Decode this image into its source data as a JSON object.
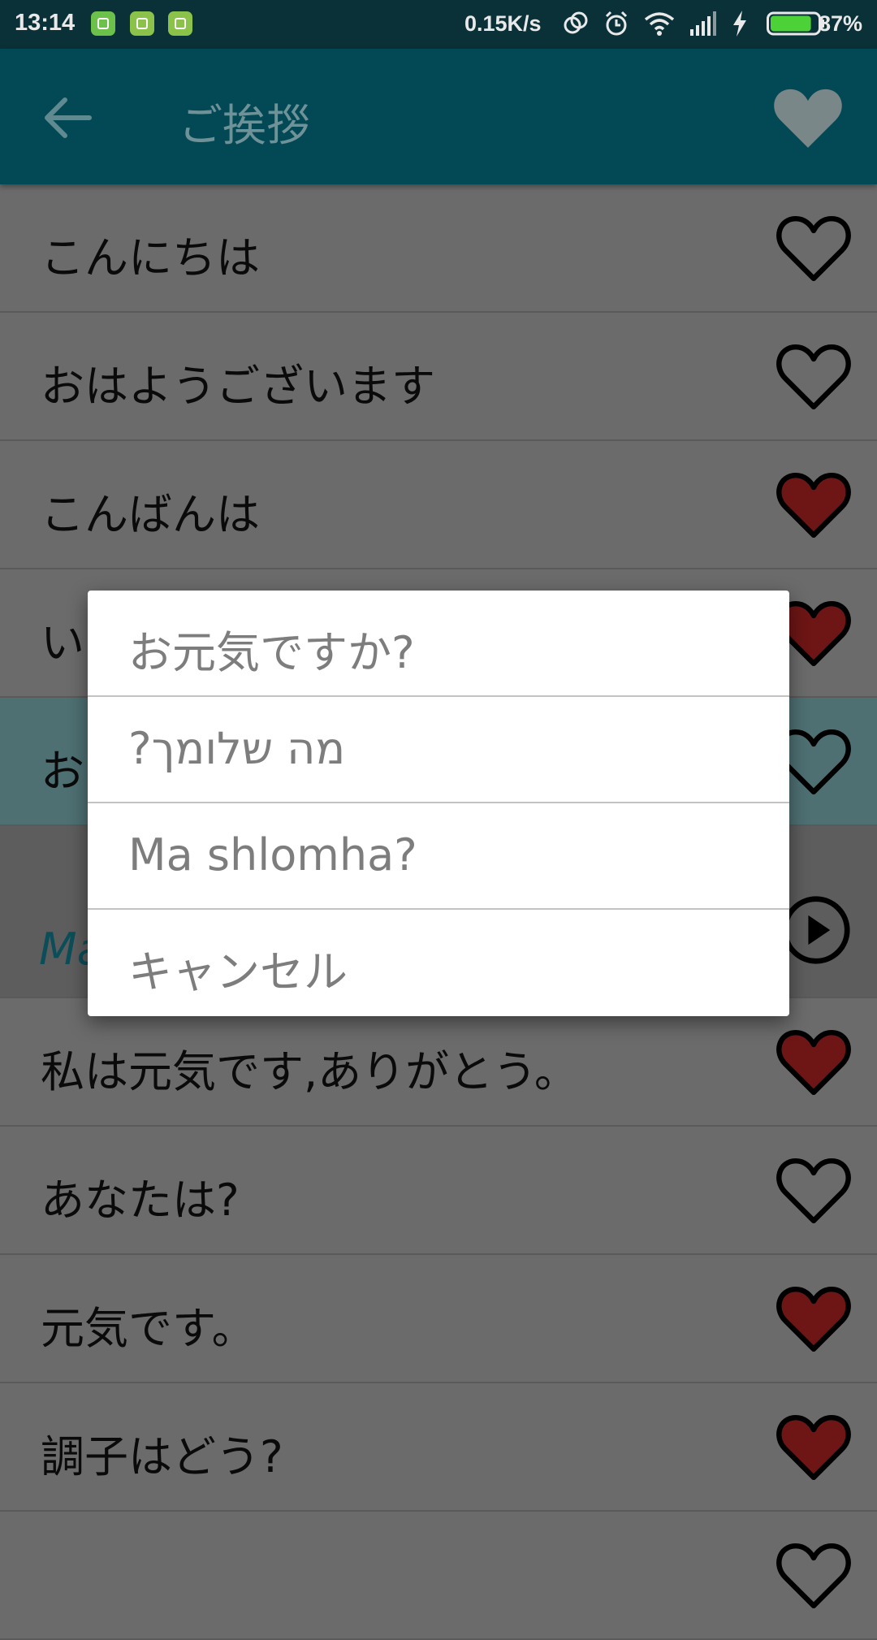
{
  "status_bar": {
    "time": "13:14",
    "notifications": [
      "line-icon",
      "sim-card-icon",
      "android-icon"
    ],
    "net_speed": "0.15K/s",
    "icons": [
      "sync-icon",
      "alarm-icon",
      "wifi-icon",
      "signal-icon",
      "charging-icon"
    ],
    "battery_percent": "87%",
    "battery_level": 0.87
  },
  "app_bar": {
    "title": "ご挨拶",
    "back_icon": "arrow-back-icon",
    "favorite_icon": "heart-icon"
  },
  "list": {
    "items": [
      {
        "text": "こんにちは",
        "favorite": false
      },
      {
        "text": "おはようございます",
        "favorite": false
      },
      {
        "text": "こんばんは",
        "favorite": true
      },
      {
        "text": "い",
        "favorite": true
      },
      {
        "text": "お",
        "favorite": false,
        "highlighted": true
      },
      {
        "text": "",
        "subtext": "Ma",
        "play_icon": "play-circle-icon"
      },
      {
        "text": "私は元気です,ありがとう。",
        "favorite": true
      },
      {
        "text": "あなたは?",
        "favorite": false
      },
      {
        "text": "元気です。",
        "favorite": true
      },
      {
        "text": "調子はどう?",
        "favorite": true
      }
    ]
  },
  "dialog": {
    "options": [
      "お元気ですか?",
      "מה שלומך?",
      "Ma shlomha?",
      "キャンセル"
    ]
  },
  "colors": {
    "status_bar": "#0b3138",
    "app_bar": "#034955",
    "heart_filled": "#6e1515",
    "scrim_background": "#6b6b6b",
    "highlight_row": "#4e7073",
    "subtitle_accent": "#0b4e59"
  }
}
